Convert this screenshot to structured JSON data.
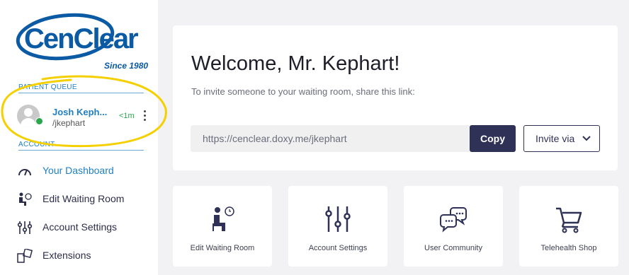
{
  "brand": {
    "logo_text": "CenClear",
    "tagline": "Since 1980",
    "logo_blue": "#0b5aa4",
    "accent_blue": "#1f7fc2"
  },
  "sidebar": {
    "patient_queue_title": "PATIENT QUEUE",
    "patient": {
      "name": "Josh Keph...",
      "handle": "/jkephart",
      "wait_time": "<1m",
      "status": "online",
      "status_color": "#27a84a"
    },
    "account_title": "ACCOUNT",
    "nav": [
      {
        "label": "Your Dashboard",
        "icon": "dashboard-gauge-icon",
        "active": true
      },
      {
        "label": "Edit Waiting Room",
        "icon": "waiting-room-icon",
        "active": false
      },
      {
        "label": "Account Settings",
        "icon": "sliders-icon",
        "active": false
      },
      {
        "label": "Extensions",
        "icon": "extensions-icon",
        "active": false
      }
    ]
  },
  "main": {
    "welcome_title": "Welcome, Mr. Kephart!",
    "invite_text": "To invite someone to your waiting room, share this link:",
    "room_link": "https://cenclear.doxy.me/jkephart",
    "copy_label": "Copy",
    "invite_label": "Invite via",
    "copy_button_color": "#2f3157",
    "tiles": [
      {
        "label": "Edit Waiting Room",
        "icon": "waiting-room-icon"
      },
      {
        "label": "Account Settings",
        "icon": "sliders-icon"
      },
      {
        "label": "User Community",
        "icon": "chat-bubbles-icon"
      },
      {
        "label": "Telehealth Shop",
        "icon": "shopping-cart-icon"
      }
    ]
  },
  "annotation": {
    "highlight_color": "#f5d000"
  }
}
